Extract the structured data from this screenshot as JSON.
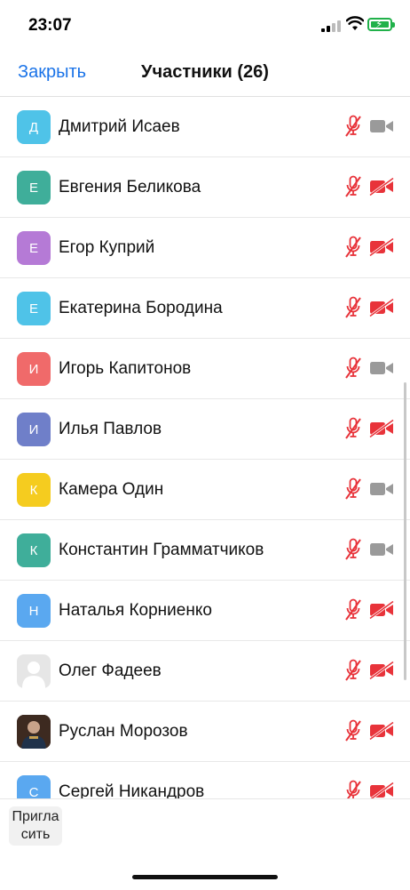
{
  "status_bar": {
    "time": "23:07"
  },
  "nav": {
    "close_label": "Закрыть",
    "title": "Участники (26)"
  },
  "participants": [
    {
      "initial": "Д",
      "name": "Дмитрий Исаев",
      "color": "#4fc3e8",
      "mic": "off",
      "camera": "on"
    },
    {
      "initial": "Е",
      "name": "Евгения Беликова",
      "color": "#3fae9a",
      "mic": "off",
      "camera": "off"
    },
    {
      "initial": "Е",
      "name": "Егор Куприй",
      "color": "#b57ad6",
      "mic": "off",
      "camera": "off"
    },
    {
      "initial": "Е",
      "name": "Екатерина Бородина",
      "color": "#4fc3e8",
      "mic": "off",
      "camera": "off"
    },
    {
      "initial": "И",
      "name": "Игорь Капитонов",
      "color": "#f06a6a",
      "mic": "off",
      "camera": "on"
    },
    {
      "initial": "И",
      "name": "Илья Павлов",
      "color": "#6f7fc9",
      "mic": "off",
      "camera": "off"
    },
    {
      "initial": "К",
      "name": "Камера Один",
      "color": "#f5cc1f",
      "mic": "off",
      "camera": "on"
    },
    {
      "initial": "К",
      "name": "Константин Грамматчиков",
      "color": "#3fae9a",
      "mic": "off",
      "camera": "on"
    },
    {
      "initial": "Н",
      "name": "Наталья Корниенко",
      "color": "#5aa8f0",
      "mic": "off",
      "camera": "off"
    },
    {
      "initial": "",
      "name": "Олег Фадеев",
      "color": "#e6e6e6",
      "avatar": "placeholder-silhouette",
      "mic": "off",
      "camera": "off"
    },
    {
      "initial": "",
      "name": "Руслан Морозов",
      "color": "#4a3226",
      "avatar": "photo",
      "mic": "off",
      "camera": "off"
    },
    {
      "initial": "С",
      "name": "Сергей Никандров",
      "color": "#5aa8f0",
      "mic": "off",
      "camera": "off"
    }
  ],
  "footer": {
    "invite_label": "Пригласить"
  },
  "colors": {
    "accent": "#1a73e8",
    "muted_red": "#e8333a",
    "icon_gray": "#9a9a9a"
  }
}
